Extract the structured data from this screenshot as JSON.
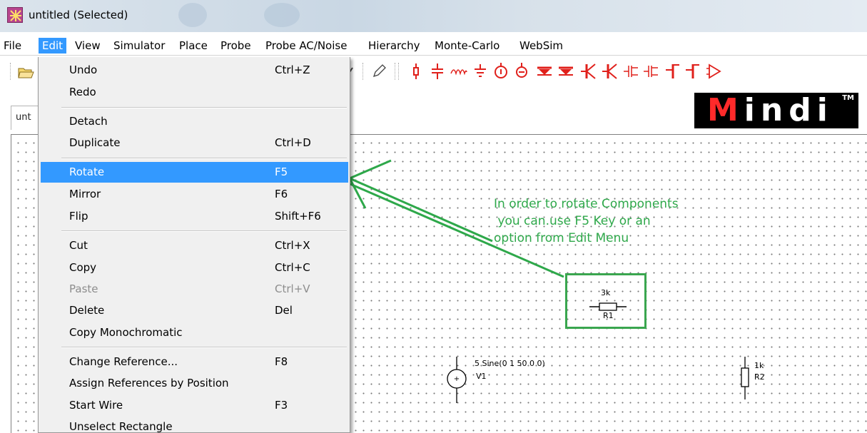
{
  "window": {
    "title": "untitled (Selected)"
  },
  "menubar": {
    "items": [
      {
        "label": "File"
      },
      {
        "label": "Edit",
        "active": true
      },
      {
        "label": "View"
      },
      {
        "label": "Simulator"
      },
      {
        "label": "Place"
      },
      {
        "label": "Probe"
      },
      {
        "label": "Probe AC/Noise"
      },
      {
        "label": "Hierarchy"
      },
      {
        "label": "Monte-Carlo"
      },
      {
        "label": "WebSim"
      }
    ]
  },
  "edit_menu": {
    "items": [
      {
        "label": "Undo",
        "shortcut": "Ctrl+Z"
      },
      {
        "label": "Redo",
        "shortcut": ""
      },
      {
        "label": "Detach",
        "shortcut": ""
      },
      {
        "label": "Duplicate",
        "shortcut": "Ctrl+D"
      },
      {
        "label": "Rotate",
        "shortcut": "F5",
        "highlighted": true
      },
      {
        "label": "Mirror",
        "shortcut": "F6"
      },
      {
        "label": "Flip",
        "shortcut": "Shift+F6"
      },
      {
        "label": "Cut",
        "shortcut": "Ctrl+X"
      },
      {
        "label": "Copy",
        "shortcut": "Ctrl+C"
      },
      {
        "label": "Paste",
        "shortcut": "Ctrl+V",
        "disabled": true
      },
      {
        "label": "Delete",
        "shortcut": "Del"
      },
      {
        "label": "Copy Monochromatic",
        "shortcut": ""
      },
      {
        "label": "Change Reference...",
        "shortcut": "F8"
      },
      {
        "label": "Assign References by Position",
        "shortcut": ""
      },
      {
        "label": "Start Wire",
        "shortcut": "F3"
      },
      {
        "label": "Unselect Rectangle",
        "shortcut": ""
      }
    ]
  },
  "document_tab": {
    "label": "unt"
  },
  "logo": {
    "first_letter": "M",
    "rest": "indi",
    "trademark": "TM"
  },
  "annotation": {
    "lines": [
      "In order to rotate Components",
      " you can.use F5 Key or an",
      "option from Edit Menu"
    ],
    "color": "#2ea84a"
  },
  "schematic": {
    "r1": {
      "value": "3k",
      "ref": "R1"
    },
    "v1": {
      "value": "5 Sine(0 1 50 0 0)",
      "ref": "V1"
    },
    "r2": {
      "value": "1k",
      "ref": "R2"
    }
  },
  "toolbar": {
    "icons": [
      "open-icon",
      "zoom-icon",
      "pencil-icon",
      "capacitor-icon",
      "battery-icon",
      "inductor-icon",
      "ground-icon",
      "current-source-icon",
      "voltage-source-icon",
      "diode-icon",
      "diode-icon",
      "transistor-icon",
      "transistor-icon",
      "mosfet-icon",
      "mosfet-icon",
      "switch-icon",
      "switch-icon",
      "opamp-icon"
    ]
  },
  "colors": {
    "menu_highlight": "#3399ff",
    "toolbar_icon": "#e0201b",
    "annotation_green": "#2ea84a"
  }
}
